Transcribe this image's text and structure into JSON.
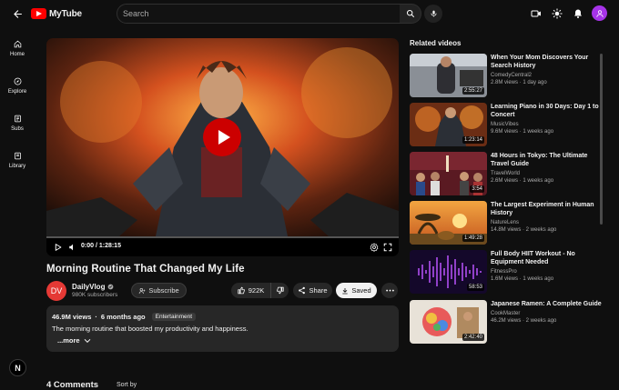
{
  "app": {
    "name": "MyTube"
  },
  "search": {
    "placeholder": "Search"
  },
  "sidebar": {
    "items": [
      {
        "label": "Home",
        "icon": "home-icon"
      },
      {
        "label": "Explore",
        "icon": "compass-icon"
      },
      {
        "label": "Subs",
        "icon": "subscriptions-icon"
      },
      {
        "label": "Library",
        "icon": "library-icon"
      }
    ],
    "badge": "N"
  },
  "player": {
    "time": "0:00 / 1:28:15",
    "progress": 0
  },
  "video": {
    "title": "Morning Routine That Changed My Life",
    "channel": {
      "initials": "DV",
      "name": "DailyVlog",
      "subscribers": "980K subscribers",
      "avatar_color": "#e53935"
    },
    "subscribe_label": "Subscribe",
    "likes": "922K",
    "share_label": "Share",
    "saved_label": "Saved",
    "views": "46.9M views",
    "age": "6 months ago",
    "tag": "Entertainment",
    "description": "The morning routine that boosted my productivity and happiness.",
    "more_label": "...more"
  },
  "comments": {
    "heading": "4 Comments",
    "sort_label": "Sort by"
  },
  "related": {
    "heading": "Related videos",
    "items": [
      {
        "title": "When Your Mom Discovers Your Search History",
        "channel": "ComedyCentral2",
        "meta": "2.8M views · 1 day ago",
        "duration": "2:55:27"
      },
      {
        "title": "Learning Piano in 30 Days: Day 1 to Concert",
        "channel": "MusicVibes",
        "meta": "9.6M views · 1 weeks ago",
        "duration": "1:23:14"
      },
      {
        "title": "48 Hours in Tokyo: The Ultimate Travel Guide",
        "channel": "TravelWorld",
        "meta": "2.6M views · 1 weeks ago",
        "duration": "3:54"
      },
      {
        "title": "The Largest Experiment in Human History",
        "channel": "NatureLens",
        "meta": "14.8M views · 2 weeks ago",
        "duration": "1:49:28"
      },
      {
        "title": "Full Body HIIT Workout - No Equipment Needed",
        "channel": "FitnessPro",
        "meta": "1.6M views · 1 weeks ago",
        "duration": "58:53"
      },
      {
        "title": "Japanese Ramen: A Complete Guide",
        "channel": "CookMaster",
        "meta": "46.2M views · 2 weeks ago",
        "duration": "2:42:40"
      }
    ]
  },
  "colors": {
    "accent": "#ff0000",
    "play_button": "#cc0000",
    "avatar_top": "#a633e8"
  }
}
